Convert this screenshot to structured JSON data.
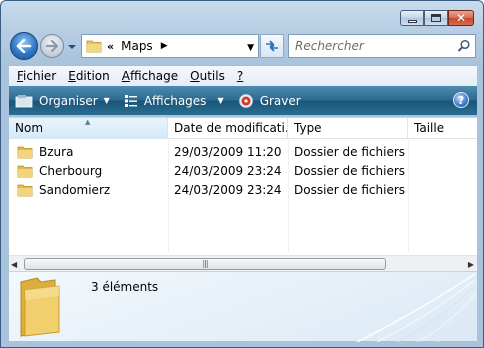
{
  "nav": {
    "breadcrumb_prefix": "«",
    "address": "Maps",
    "search_placeholder": "Rechercher"
  },
  "menu": [
    {
      "underline": "F",
      "rest": "ichier"
    },
    {
      "underline": "E",
      "rest": "dition"
    },
    {
      "underline": "A",
      "rest": "ffichage"
    },
    {
      "underline": "O",
      "rest": "utils"
    },
    {
      "underline": "?",
      "rest": ""
    }
  ],
  "commands": {
    "organize": "Organiser",
    "views": "Affichages",
    "burn": "Graver",
    "help": "?"
  },
  "columns": {
    "name": "Nom",
    "date": "Date de modificati...",
    "type": "Type",
    "size": "Taille"
  },
  "files": [
    {
      "name": "Bzura",
      "date": "29/03/2009 11:20",
      "type": "Dossier de fichiers"
    },
    {
      "name": "Cherbourg",
      "date": "24/03/2009 23:24",
      "type": "Dossier de fichiers"
    },
    {
      "name": "Sandomierz",
      "date": "24/03/2009 23:24",
      "type": "Dossier de fichiers"
    }
  ],
  "details": {
    "count": "3 éléments"
  },
  "colors": {
    "command_bar": "#2c6a90",
    "folder": "#e8c45a",
    "accent_blue": "#2f78c7"
  }
}
